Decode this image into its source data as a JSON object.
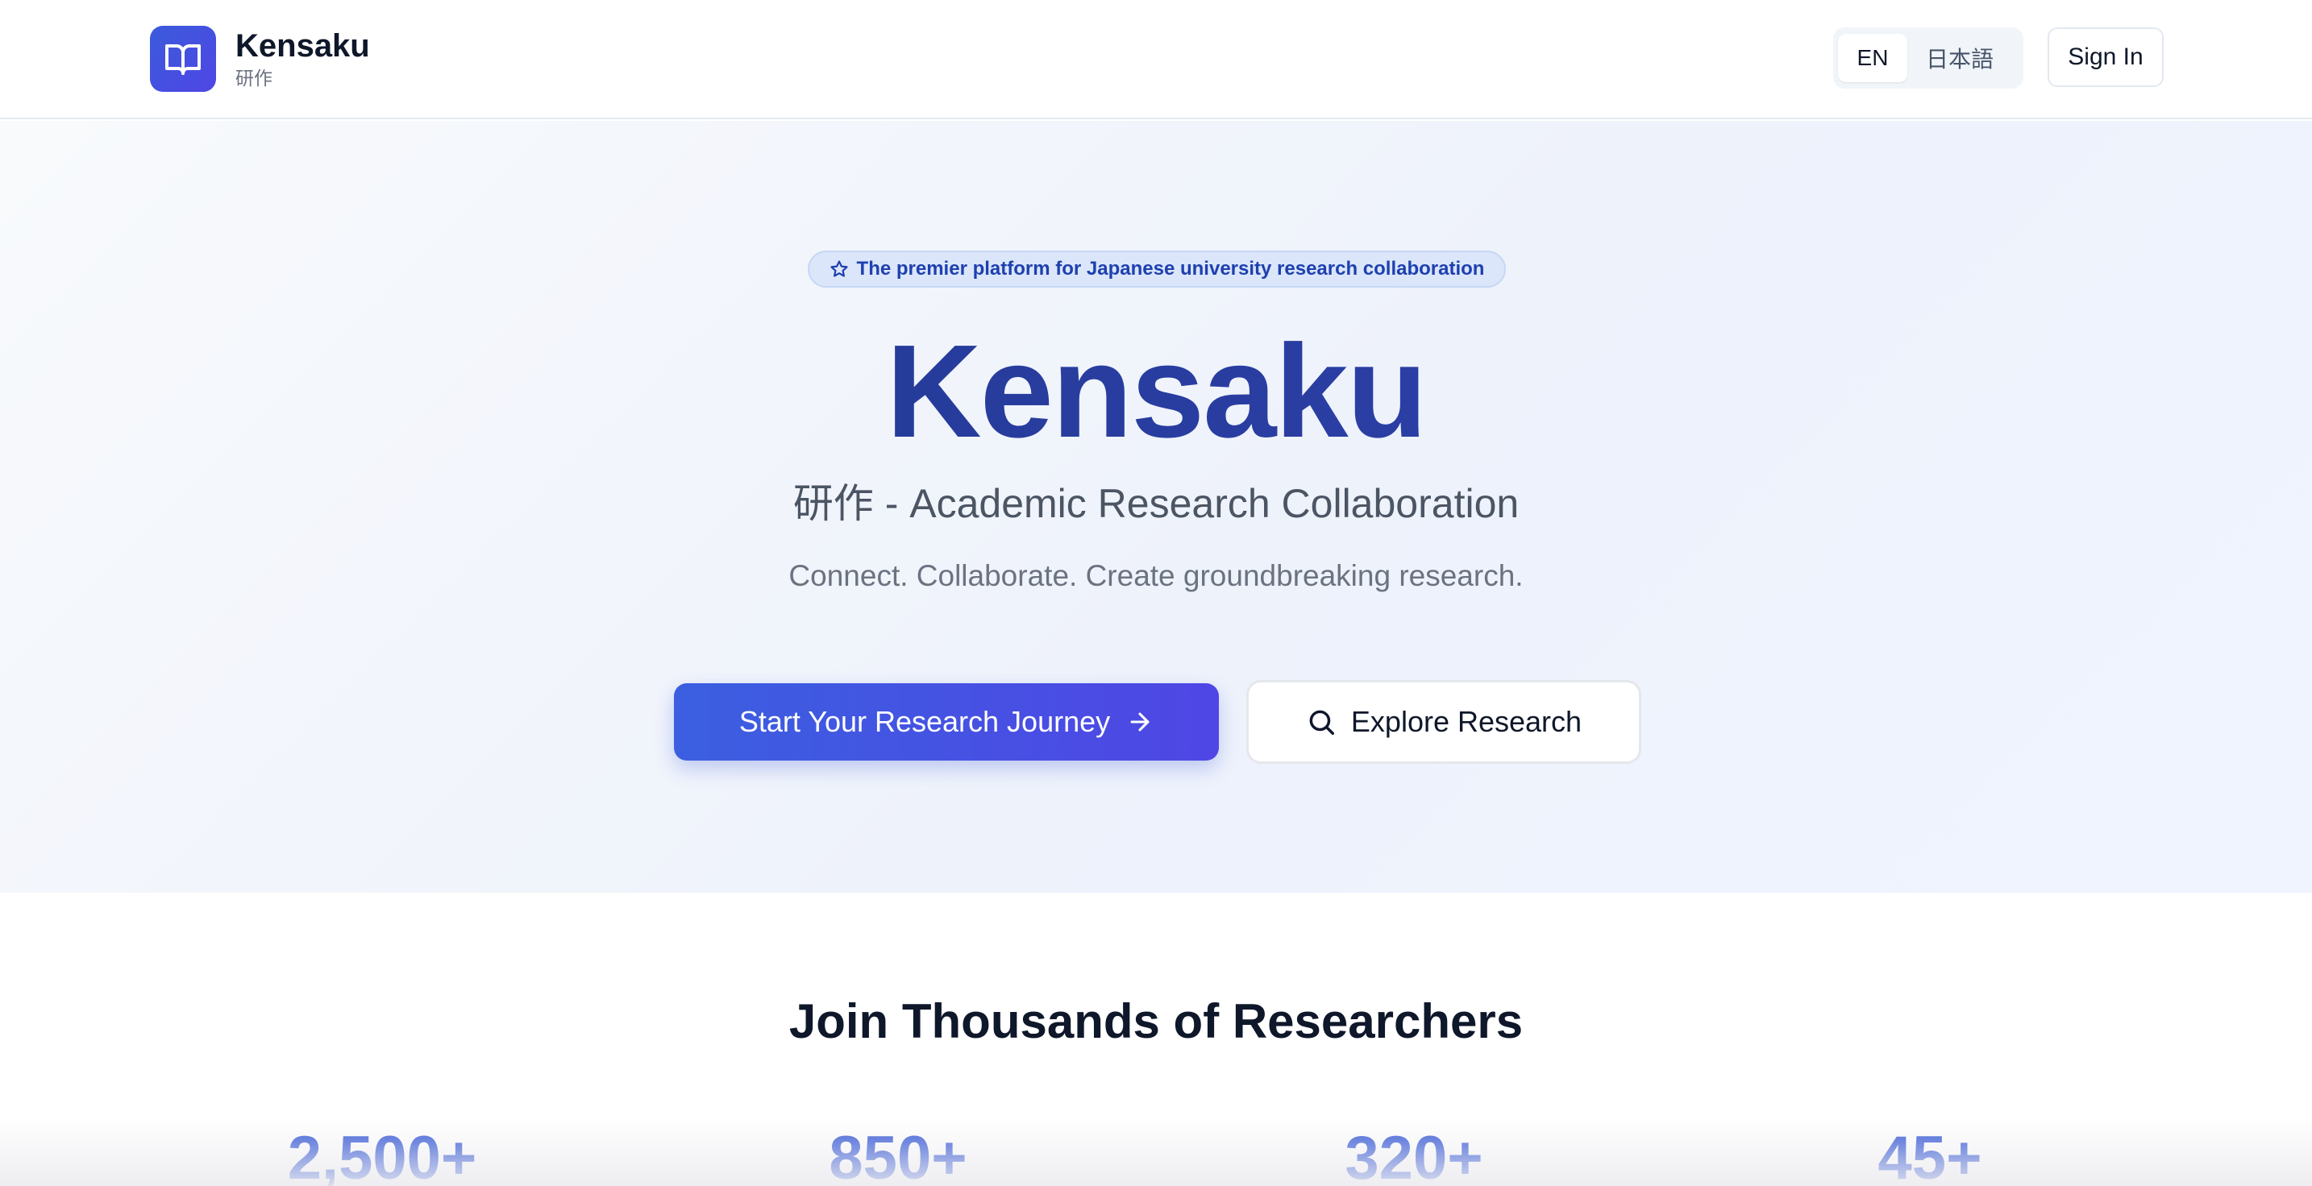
{
  "header": {
    "brand_name": "Kensaku",
    "brand_subtitle": "研作",
    "logo_icon": "book-open-icon",
    "languages": [
      {
        "label": "EN",
        "active": true
      },
      {
        "label": "日本語",
        "active": false
      }
    ],
    "sign_in_label": "Sign In"
  },
  "hero": {
    "badge_icon": "star-icon",
    "badge_text": "The premier platform for Japanese university research collaboration",
    "title": "Kensaku",
    "subtitle": "研作 - Academic Research Collaboration",
    "tagline": "Connect. Collaborate. Create groundbreaking research.",
    "primary_cta": {
      "label": "Start Your Research Journey",
      "icon": "arrow-right-icon"
    },
    "secondary_cta": {
      "label": "Explore Research",
      "icon": "search-icon"
    }
  },
  "stats": {
    "heading": "Join Thousands of Researchers",
    "items": [
      {
        "value": "2,500+"
      },
      {
        "value": "850+"
      },
      {
        "value": "320+"
      },
      {
        "value": "45+"
      }
    ]
  },
  "colors": {
    "brand": "#4f46e5",
    "title": "#1e3a8a",
    "stat_value": "#3558d6",
    "badge_bg": "#dbe6fb"
  }
}
